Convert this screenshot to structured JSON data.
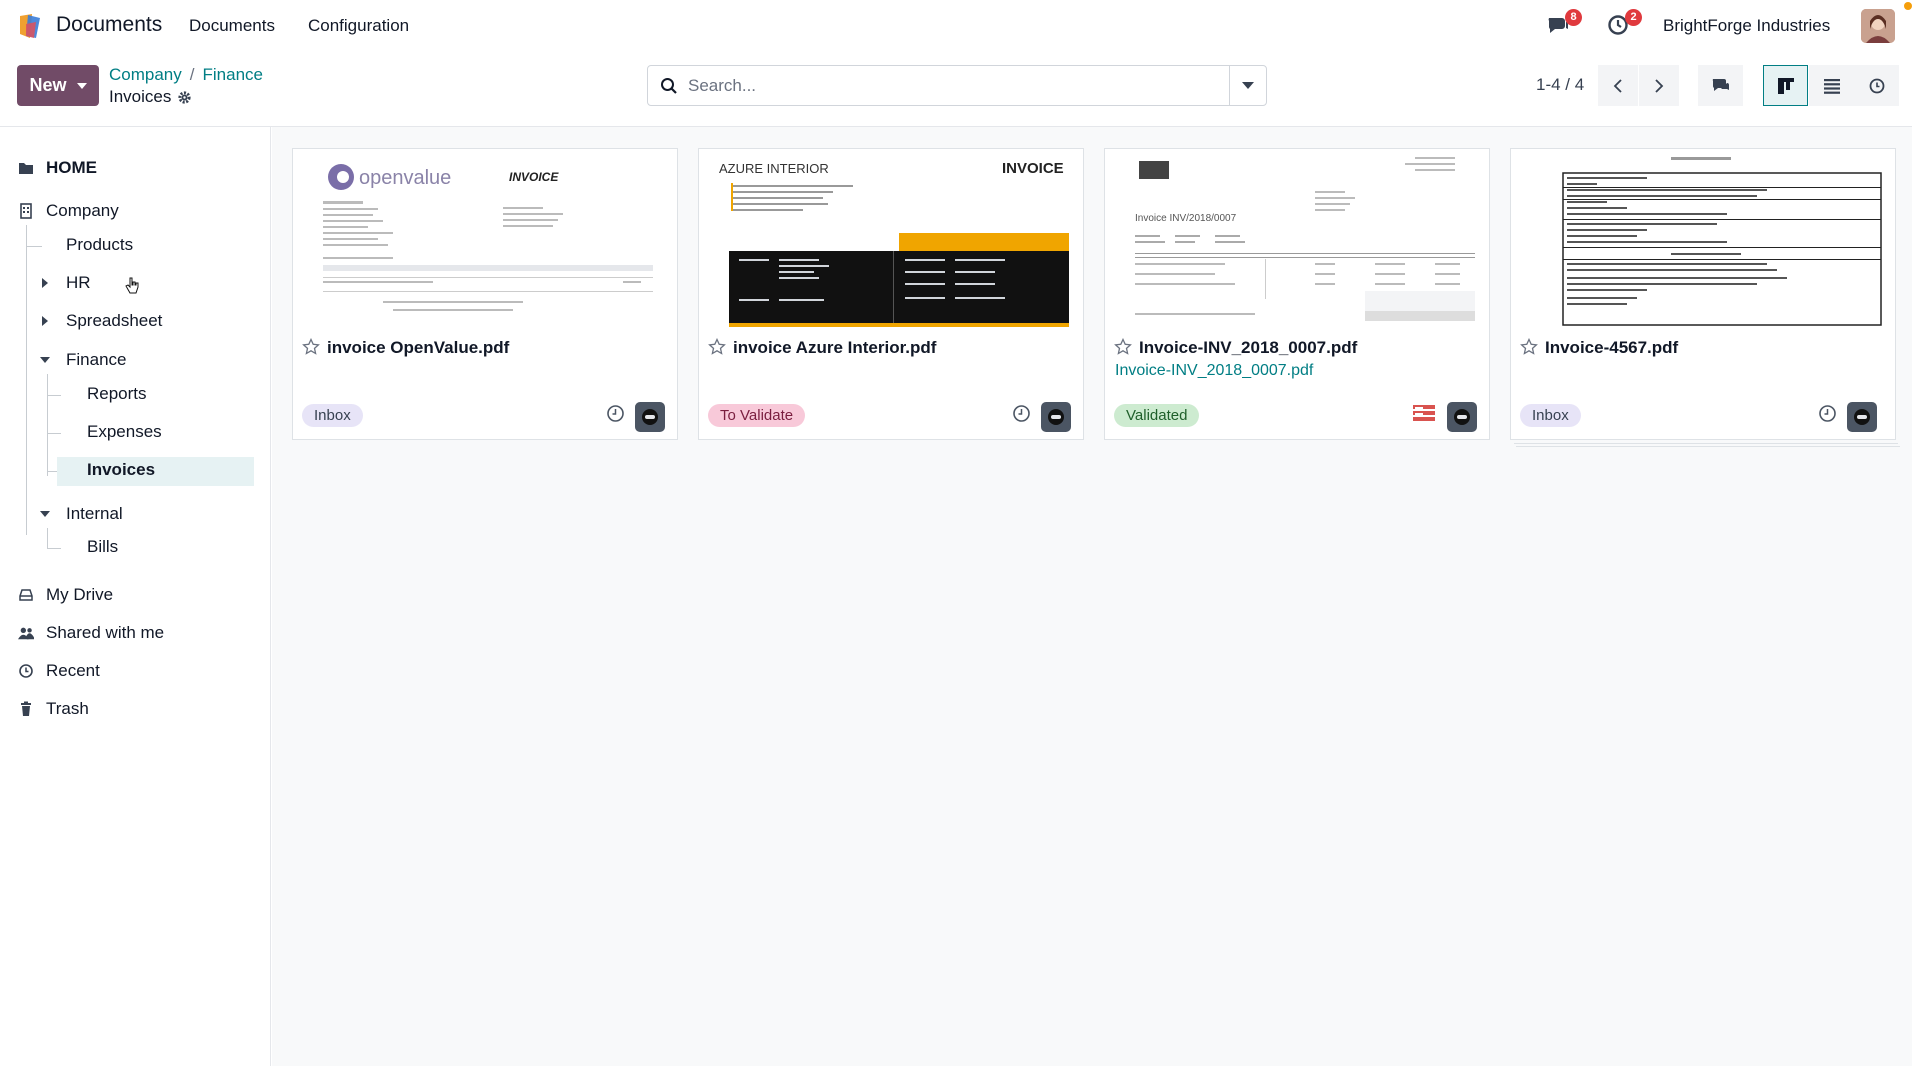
{
  "navbar": {
    "app_name": "Documents",
    "menus": [
      "Documents",
      "Configuration"
    ],
    "messages_count": "8",
    "activities_count": "2",
    "company": "BrightForge Industries"
  },
  "control_panel": {
    "new_label": "New",
    "breadcrumb": [
      "Company",
      "Finance"
    ],
    "current": "Invoices",
    "search_placeholder": "Search...",
    "pager": "1-4 / 4"
  },
  "sidebar": {
    "home": "HOME",
    "company": "Company",
    "products": "Products",
    "hr": "HR",
    "spreadsheet": "Spreadsheet",
    "finance": "Finance",
    "reports": "Reports",
    "expenses": "Expenses",
    "invoices": "Invoices",
    "internal": "Internal",
    "bills": "Bills",
    "my_drive": "My Drive",
    "shared": "Shared with me",
    "recent": "Recent",
    "trash": "Trash"
  },
  "cards": [
    {
      "title": "invoice OpenValue.pdf",
      "subtitle": "",
      "tag": "Inbox",
      "thumb_brand": "openvalue",
      "thumb_heading": "INVOICE"
    },
    {
      "title": "invoice Azure Interior.pdf",
      "subtitle": "",
      "tag": "To Validate",
      "thumb_brand": "AZURE INTERIOR",
      "thumb_heading": "INVOICE"
    },
    {
      "title": "Invoice-INV_2018_0007.pdf",
      "subtitle": "Invoice-INV_2018_0007.pdf",
      "tag": "Validated",
      "thumb_heading": "Invoice INV/2018/0007"
    },
    {
      "title": "Invoice-4567.pdf",
      "subtitle": "",
      "tag": "Inbox"
    }
  ],
  "colors": {
    "brand": "#714b67",
    "link": "#017e84",
    "badge": "#e03a3e"
  }
}
